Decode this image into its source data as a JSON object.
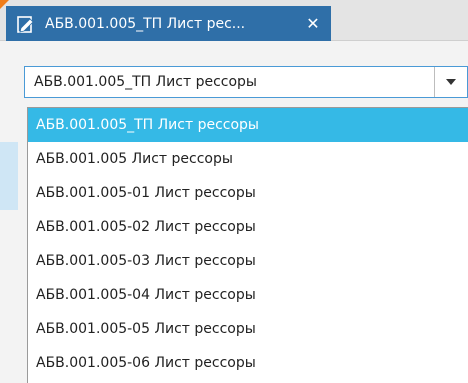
{
  "tab": {
    "title": "АБВ.001.005_ТП Лист рес...",
    "icon": "document-edit-icon",
    "close_label": "✕"
  },
  "combo": {
    "value": "АБВ.001.005_ТП Лист рессоры",
    "arrow_icon": "chevron-down-icon"
  },
  "dropdown": {
    "selected_index": 0,
    "options": [
      "АБВ.001.005_ТП Лист рессоры",
      "АБВ.001.005 Лист рессоры",
      "АБВ.001.005-01 Лист рессоры",
      "АБВ.001.005-02 Лист рессоры",
      "АБВ.001.005-03 Лист рессоры",
      "АБВ.001.005-04 Лист рессоры",
      "АБВ.001.005-05 Лист рессоры",
      "АБВ.001.005-06 Лист рессоры"
    ]
  },
  "colors": {
    "tab_background": "#2f6fa8",
    "selection": "#35b9e6",
    "focus_border": "#4a9ad6"
  }
}
